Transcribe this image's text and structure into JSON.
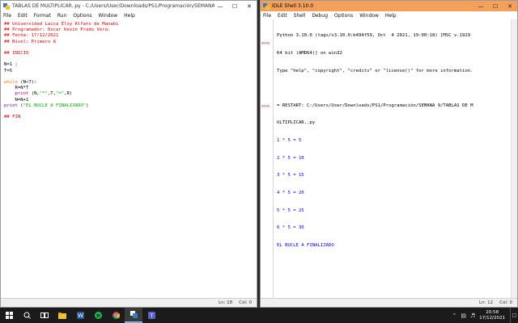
{
  "editor": {
    "title": "TABLAS DE MULTIPLICAR..py - C:/Users/User/Downloads/PS1/Programación/SEMANA ...",
    "menu": [
      "File",
      "Edit",
      "Format",
      "Run",
      "Options",
      "Window",
      "Help"
    ],
    "code_lines": [
      "## Universidad Laica Eloy Alfaro de Manabí",
      "## Programador: Oscar Kevin Prado Vera.",
      "## Fecha: 17/12/2021",
      "## Nivel: Primero A",
      "",
      "## INICIO",
      "",
      "N=1 ;",
      "T=5",
      "",
      "while (N<7):",
      "    R=N*T",
      "    print (N,\"*\",T,\"=\",R)",
      "    N=N+1",
      "print (\"EL BUCLE A FINALIZADO\")",
      "",
      "## FIN"
    ],
    "status": {
      "line": "Ln: 18",
      "col": "Col: 0"
    }
  },
  "shell": {
    "title": "IDLE Shell 3.10.0",
    "menu": [
      "File",
      "Edit",
      "Shell",
      "Debug",
      "Options",
      "Window",
      "Help"
    ],
    "banner": [
      "Python 3.10.0 (tags/v3.10.0:b494f59, Oct  4 2021, 19:00:18) [MSC v.1929",
      "64 bit (AMD64)] on win32",
      "Type \"help\", \"copyright\", \"credits\" or \"license()\" for more information."
    ],
    "restart": [
      "= RESTART: C:/Users/User/Downloads/PS1/Programación/SEMANA 9/TABLAS DE M",
      "ULTIPLICAR..py"
    ],
    "output": [
      "1 * 5 = 5",
      "2 * 5 = 10",
      "3 * 5 = 15",
      "4 * 5 = 20",
      "5 * 5 = 25",
      "6 * 5 = 30",
      "EL BUCLE A FINALIZADO"
    ],
    "prompt": ">>>",
    "status": {
      "line": "Ln: 12",
      "col": "Col: 0"
    }
  },
  "taskbar": {
    "time": "20:58",
    "date": "17/12/2021",
    "apps": [
      "start-icon",
      "search-icon",
      "task-view-icon",
      "file-explorer-icon",
      "word-icon",
      "spotify-icon",
      "chrome-icon",
      "python-idle-icon",
      "teams-icon"
    ]
  },
  "colors": {
    "shell_title_bg": "#f4a05a",
    "comment": "#dd0000",
    "keyword": "#ff7700",
    "string": "#00aa00",
    "builtin": "#900090",
    "output": "#0000ff"
  }
}
